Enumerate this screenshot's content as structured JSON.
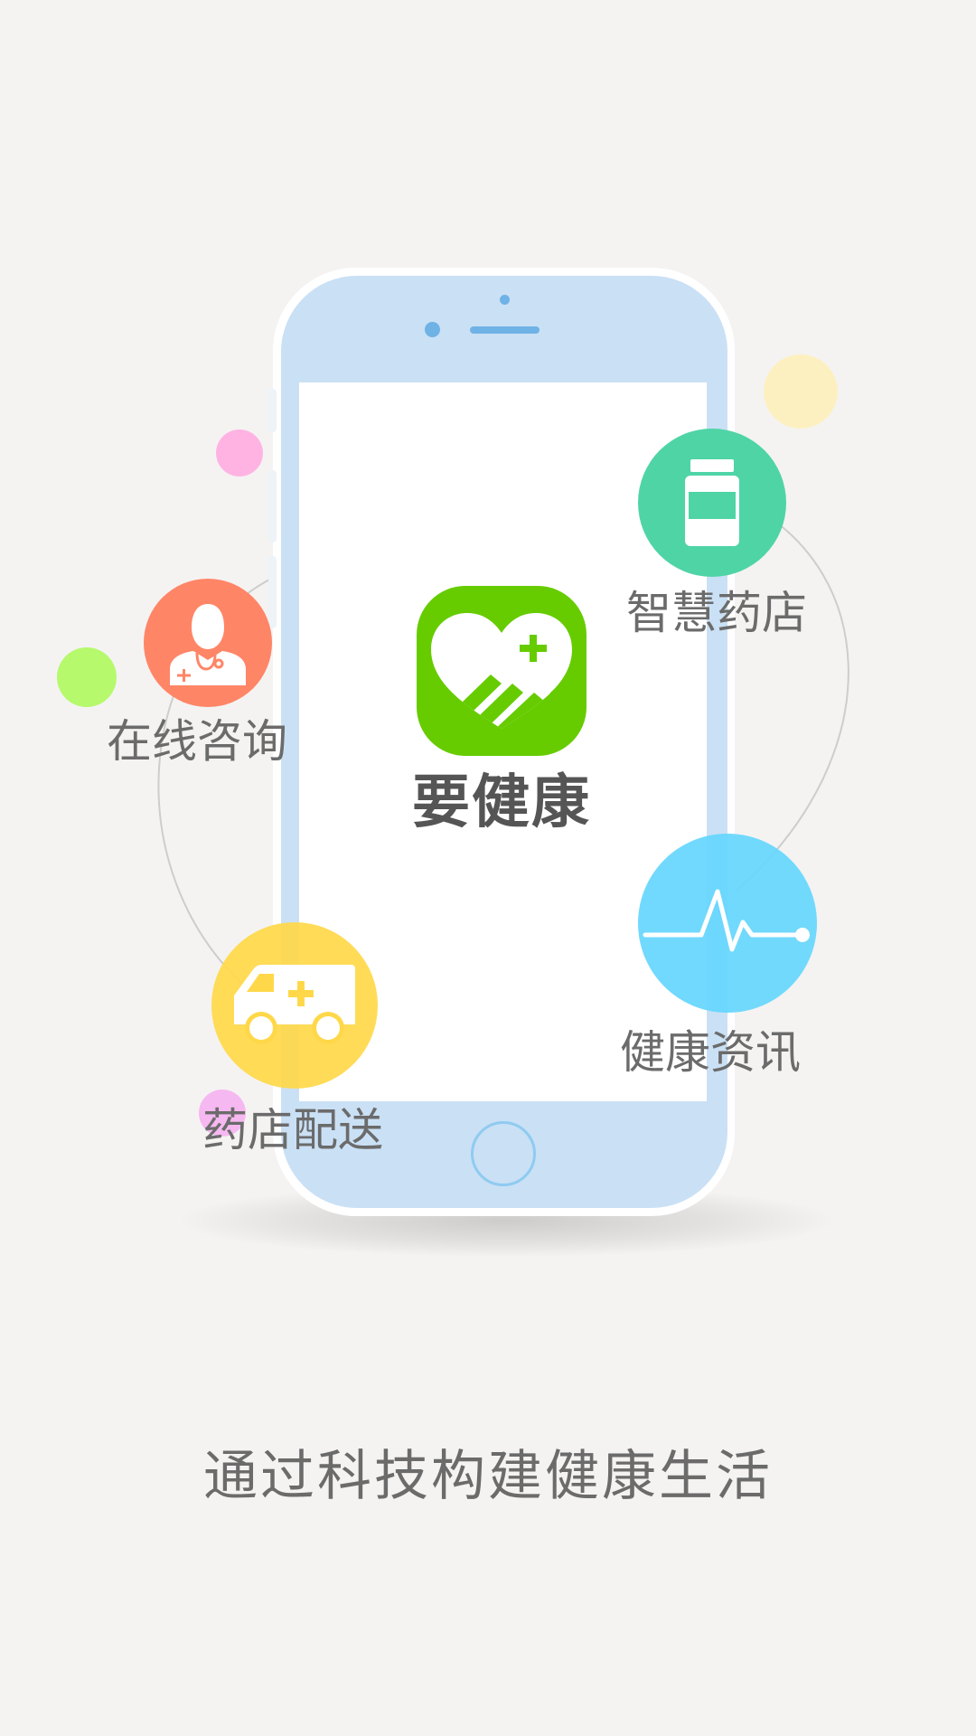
{
  "app": {
    "name": "要健康"
  },
  "features": {
    "pharmacy": {
      "label": "智慧药店",
      "color": "#4fd4a6",
      "icon": "medicine-bottle-icon"
    },
    "consult": {
      "label": "在线咨询",
      "color": "#ff8567",
      "icon": "doctor-icon"
    },
    "delivery": {
      "label": "药店配送",
      "color": "#ffd84a",
      "icon": "ambulance-icon"
    },
    "news": {
      "label": "健康资讯",
      "color": "#66d6fd",
      "icon": "heartbeat-icon"
    }
  },
  "tagline": "通过科技构建健康生活",
  "colors": {
    "background": "#f4f3f2",
    "phone_body": "#cae0f5",
    "logo_green": "#66cc00",
    "text_gray": "#6b6b6b"
  }
}
